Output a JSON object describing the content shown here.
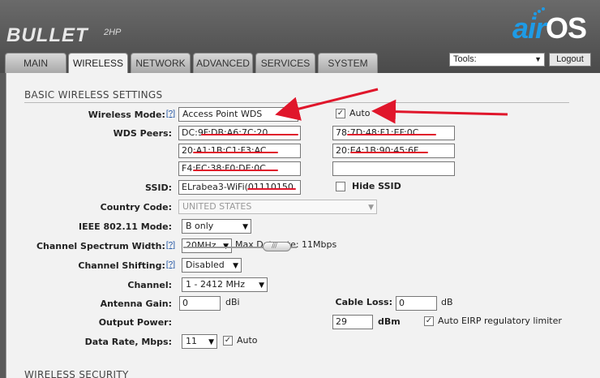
{
  "brand": {
    "name": "BULLET",
    "model": "2HP",
    "logo_air": "air",
    "logo_os": "OS"
  },
  "tabs": [
    "MAIN",
    "WIRELESS",
    "NETWORK",
    "ADVANCED",
    "SERVICES",
    "SYSTEM"
  ],
  "active_tab": "WIRELESS",
  "tools": {
    "label": "Tools:",
    "logout": "Logout"
  },
  "section_basic": "BASIC WIRELESS SETTINGS",
  "section_security": "WIRELESS SECURITY",
  "help_mark": "[?]",
  "wireless_mode": {
    "label": "Wireless Mode:",
    "value": "Access Point WDS",
    "auto_label": "Auto",
    "auto_checked": true
  },
  "wds": {
    "label": "WDS Peers:",
    "peers": [
      "DC:9F:DB:A6:7C:20",
      "78:7D:48:F1:EF:0C",
      "20:A1:1B:C1:F3:AC",
      "20:E4:1B:90:45:6F",
      "F4:EC:38:F0:DE:0C",
      ""
    ]
  },
  "ssid": {
    "label": "SSID:",
    "value": "ELrabea3-WiFi(01110150",
    "hide_label": "Hide SSID",
    "hide_checked": false
  },
  "country": {
    "label": "Country Code:",
    "value": "UNITED STATES"
  },
  "ieee": {
    "label": "IEEE 802.11 Mode:",
    "value": "B only"
  },
  "spectrum": {
    "label": "Channel Spectrum Width:",
    "value": "20MHz",
    "max_text": "Max Datarate: 11Mbps"
  },
  "shifting": {
    "label": "Channel Shifting:",
    "value": "Disabled"
  },
  "channel": {
    "label": "Channel:",
    "value": "1 - 2412 MHz"
  },
  "antenna": {
    "label": "Antenna Gain:",
    "value": "0",
    "unit": "dBi"
  },
  "cable": {
    "label": "Cable Loss:",
    "value": "0",
    "unit": "dB"
  },
  "power": {
    "label": "Output Power:",
    "value": "29",
    "unit": "dBm",
    "level": 0.9,
    "eirp_label": "Auto EIRP regulatory limiter",
    "eirp_checked": true
  },
  "datarate": {
    "label": "Data Rate, Mbps:",
    "value": "11",
    "auto_label": "Auto",
    "auto_checked": true
  },
  "colors": {
    "annotation": "#e0162b",
    "logo_blue": "#1e9be6",
    "header": "#5a5a5a"
  }
}
